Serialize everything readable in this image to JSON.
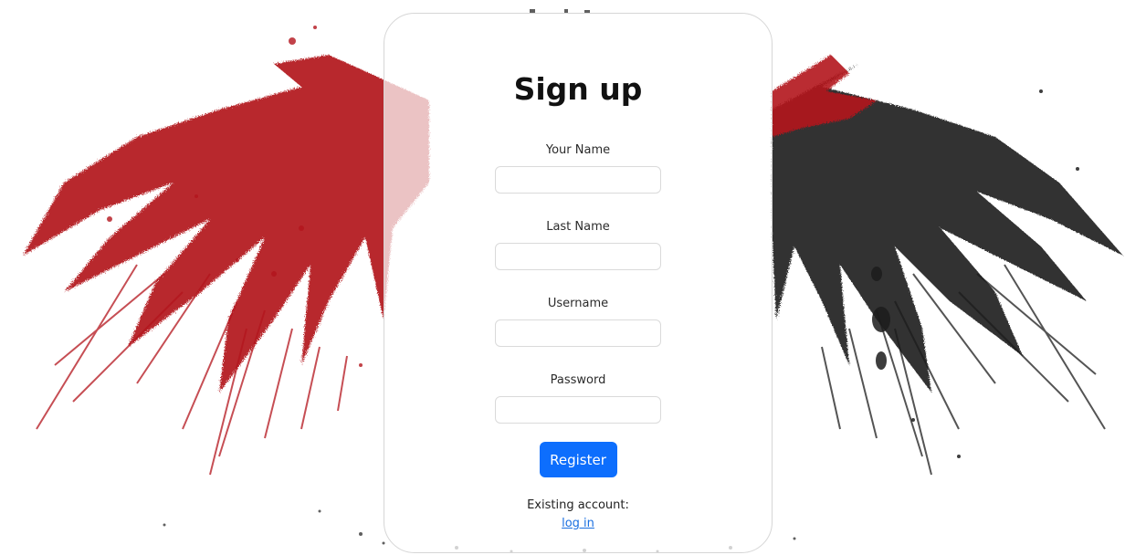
{
  "form": {
    "title": "Sign up",
    "fields": [
      {
        "label": "Your Name",
        "value": "",
        "placeholder": ""
      },
      {
        "label": "Last Name",
        "value": "",
        "placeholder": ""
      },
      {
        "label": "Username",
        "value": "",
        "placeholder": ""
      },
      {
        "label": "Password",
        "value": "",
        "placeholder": ""
      }
    ],
    "register_label": "Register",
    "existing_text": "Existing account:",
    "login_link": "log in"
  },
  "colors": {
    "primary_button": "#0d6efd",
    "link": "#1a6fe0",
    "splatter_red": "#b3141c",
    "splatter_black": "#1c1c1c"
  },
  "background": {
    "icon": "eagle-splatter-icon"
  }
}
